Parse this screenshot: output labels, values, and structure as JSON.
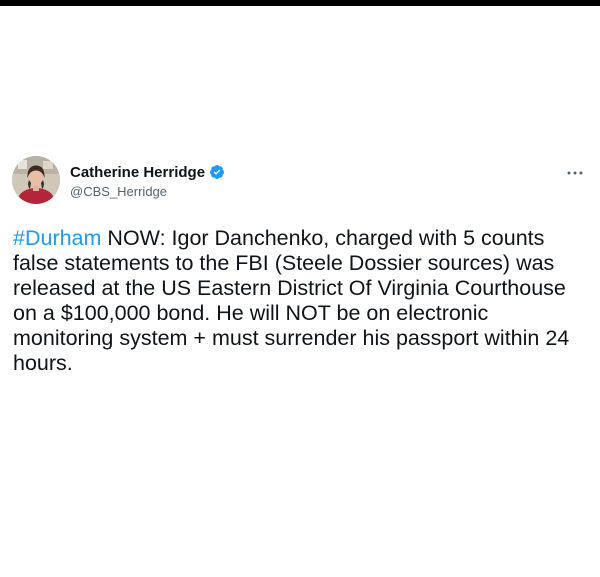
{
  "tweet": {
    "author": {
      "display_name": "Catherine Herridge",
      "handle": "@CBS_Herridge",
      "verified": true
    },
    "hashtag": "#Durham",
    "body": " NOW: Igor Danchenko, charged with 5 counts false statements to the FBI (Steele Dossier sources) was released at the US Eastern District Of Virginia Courthouse on a $100,000 bond. He will NOT be on electronic monitoring system + must surrender his passport within 24 hours."
  },
  "icons": {
    "verified": "verified-badge-icon",
    "more": "more-options-icon"
  },
  "colors": {
    "link": "#1d9bf0",
    "text": "#0f1419",
    "secondary_text": "#536471",
    "verified_badge": "#1d9bf0"
  }
}
